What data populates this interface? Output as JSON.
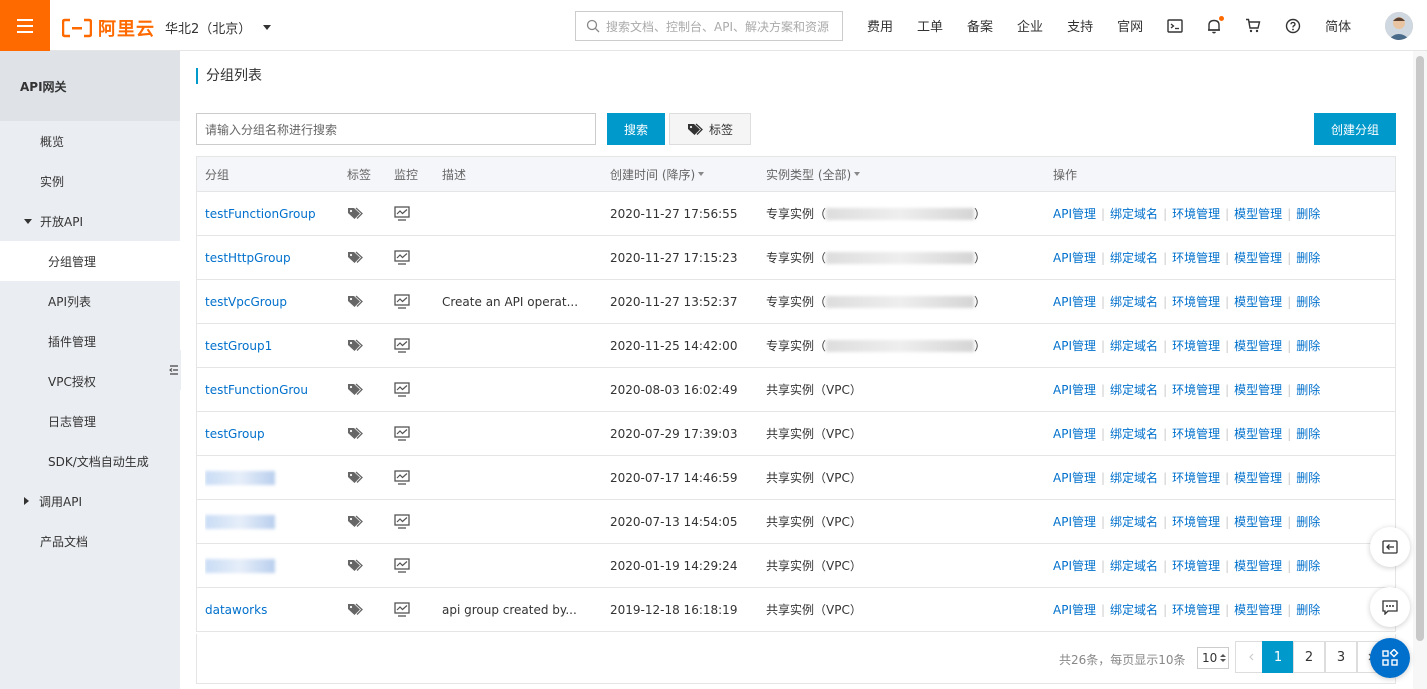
{
  "topbar": {
    "brand": "阿里云",
    "region": "华北2（北京）",
    "search_placeholder": "搜索文档、控制台、API、解决方案和资源",
    "nav": [
      "费用",
      "工单",
      "备案",
      "企业",
      "支持",
      "官网"
    ],
    "lang": "简体"
  },
  "sidebar": {
    "title": "API网关",
    "items": [
      {
        "label": "概览"
      },
      {
        "label": "实例"
      },
      {
        "label": "开放API"
      },
      {
        "label": "分组管理"
      },
      {
        "label": "API列表"
      },
      {
        "label": "插件管理"
      },
      {
        "label": "VPC授权"
      },
      {
        "label": "日志管理"
      },
      {
        "label": "SDK/文档自动生成"
      },
      {
        "label": "调用API"
      },
      {
        "label": "产品文档"
      }
    ]
  },
  "main": {
    "title": "分组列表",
    "search_placeholder": "请输入分组名称进行搜索",
    "search_btn": "搜索",
    "tag_btn": "标签",
    "create_btn": "创建分组"
  },
  "table": {
    "headers": {
      "name": "分组",
      "tag": "标签",
      "monitor": "监控",
      "desc": "描述",
      "time": "创建时间 (降序)",
      "type": "实例类型 (全部)",
      "ops": "操作"
    },
    "ops": [
      "API管理",
      "绑定域名",
      "环境管理",
      "模型管理",
      "删除"
    ],
    "rows": [
      {
        "name": "testFunctionGroup",
        "desc": "",
        "time": "2020-11-27 17:56:55",
        "type": "专享实例（",
        "type_end": "）"
      },
      {
        "name": "testHttpGroup",
        "desc": "",
        "time": "2020-11-27 17:15:23",
        "type": "专享实例（",
        "type_end": "）"
      },
      {
        "name": "testVpcGroup",
        "desc": "Create an API operat...",
        "time": "2020-11-27 13:52:37",
        "type": "专享实例（",
        "type_end": "）"
      },
      {
        "name": "testGroup1",
        "desc": "",
        "time": "2020-11-25 14:42:00",
        "type": "专享实例（",
        "type_end": "）"
      },
      {
        "name": "testFunctionGrou",
        "desc": "",
        "time": "2020-08-03 16:02:49",
        "type": "共享实例（VPC）",
        "type_end": ""
      },
      {
        "name": "testGroup",
        "desc": "",
        "time": "2020-07-29 17:39:03",
        "type": "共享实例（VPC）",
        "type_end": ""
      },
      {
        "name": "",
        "desc": "",
        "time": "2020-07-17 14:46:59",
        "type": "共享实例（VPC）",
        "type_end": ""
      },
      {
        "name": "",
        "desc": "",
        "time": "2020-07-13 14:54:05",
        "type": "共享实例（VPC）",
        "type_end": ""
      },
      {
        "name": "",
        "desc": "",
        "time": "2020-01-19 14:29:24",
        "type": "共享实例（VPC）",
        "type_end": ""
      },
      {
        "name": "dataworks",
        "desc": "api group created by...",
        "time": "2019-12-18 16:18:19",
        "type": "共享实例（VPC）",
        "type_end": ""
      }
    ]
  },
  "pagination": {
    "summary": "共26条，每页显示10条",
    "page_size": "10",
    "pages": [
      "1",
      "2",
      "3"
    ],
    "current": "1"
  },
  "colors": {
    "brand": "#ff6a00",
    "primary": "#0099cc",
    "link": "#0070cc"
  }
}
